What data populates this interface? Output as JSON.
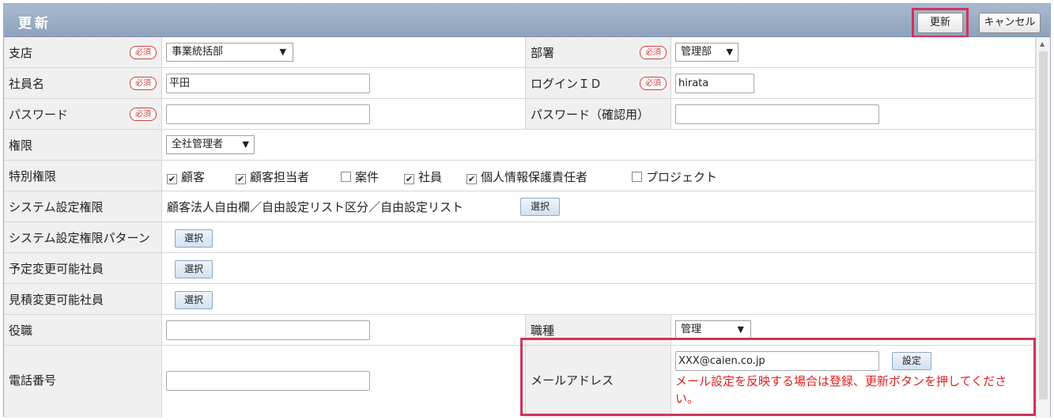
{
  "header": {
    "title": "更新",
    "update_button": "更新",
    "cancel_button": "キャンセル"
  },
  "required_badge": "必須",
  "select_button_label": "選択",
  "rows": {
    "branch": {
      "label": "支店",
      "value": "事業統括部"
    },
    "department": {
      "label": "部署",
      "value": "管理部"
    },
    "employee_name": {
      "label": "社員名",
      "value": "平田"
    },
    "login_id": {
      "label": "ログインＩＤ",
      "value": "hirata"
    },
    "password": {
      "label": "パスワード",
      "value": ""
    },
    "password_confirm": {
      "label": "パスワード（確認用）",
      "value": ""
    },
    "authority": {
      "label": "権限",
      "value": "全社管理者"
    },
    "special_authority": {
      "label": "特別権限",
      "options": [
        {
          "label": "顧客",
          "checked": true
        },
        {
          "label": "顧客担当者",
          "checked": true
        },
        {
          "label": "案件",
          "checked": false
        },
        {
          "label": "社員",
          "checked": true
        },
        {
          "label": "個人情報保護責任者",
          "checked": true
        },
        {
          "label": "プロジェクト",
          "checked": false
        }
      ]
    },
    "system_setting_authority": {
      "label": "システム設定権限",
      "value": "顧客法人自由欄／自由設定リスト区分／自由設定リスト"
    },
    "system_setting_pattern": {
      "label": "システム設定権限パターン"
    },
    "schedule_change_employee": {
      "label": "予定変更可能社員"
    },
    "estimate_change_employee": {
      "label": "見積変更可能社員"
    },
    "position": {
      "label": "役職",
      "value": ""
    },
    "job_type": {
      "label": "職種",
      "value": "管理"
    },
    "phone": {
      "label": "電話番号",
      "value": ""
    },
    "email": {
      "label": "メールアドレス",
      "value": "XXX@caien.co.jp",
      "set_button": "設定",
      "note": "メール設定を反映する場合は登録、更新ボタンを押してください。"
    }
  },
  "colors": {
    "header_bg": "#98abc5",
    "required": "#d04040",
    "note": "#e02020",
    "highlight": "#d0345a"
  }
}
